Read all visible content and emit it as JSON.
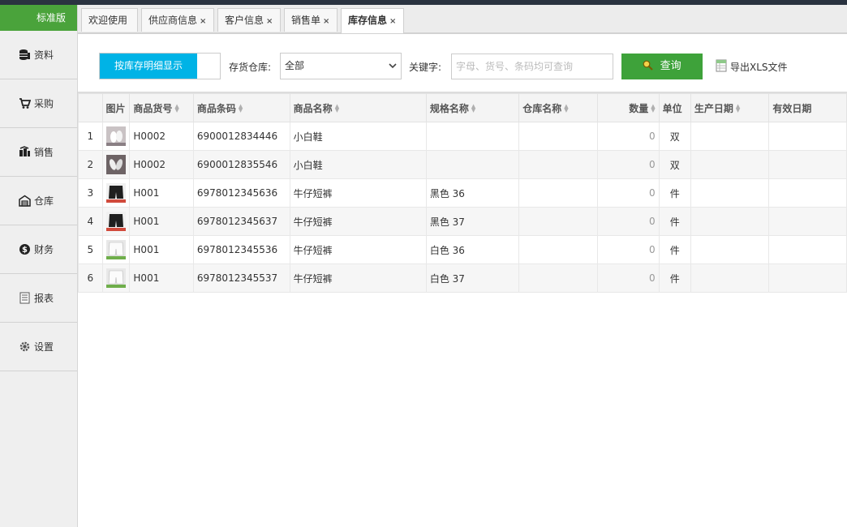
{
  "sidebar": {
    "edition": "标准版",
    "items": [
      {
        "label": "资料",
        "icon": "database-icon"
      },
      {
        "label": "采购",
        "icon": "cart-icon"
      },
      {
        "label": "销售",
        "icon": "sales-icon"
      },
      {
        "label": "仓库",
        "icon": "warehouse-icon"
      },
      {
        "label": "财务",
        "icon": "dollar-icon"
      },
      {
        "label": "报表",
        "icon": "report-icon"
      },
      {
        "label": "设置",
        "icon": "gear-icon"
      }
    ]
  },
  "tabs": [
    {
      "label": "欢迎使用"
    },
    {
      "label": "供应商信息",
      "close": "×"
    },
    {
      "label": "客户信息",
      "close": "×"
    },
    {
      "label": "销售单",
      "close": "×"
    },
    {
      "label": "库存信息",
      "close": "×",
      "active": true
    }
  ],
  "filters": {
    "detail_button": "按库存明细显示",
    "warehouse_label": "存货仓库:",
    "warehouse_value": "全部",
    "keyword_label": "关键字:",
    "keyword_placeholder": "字母、货号、条码均可查询",
    "query_button": "查询",
    "export_label": "导出XLS文件"
  },
  "table": {
    "columns": [
      "图片",
      "商品货号",
      "商品条码",
      "商品名称",
      "规格名称",
      "仓库名称",
      "数量",
      "单位",
      "生产日期",
      "有效日期"
    ],
    "rows": [
      {
        "no": "1",
        "image": "shoe-light",
        "code": "H0002",
        "barcode": "6900012834446",
        "name": "小白鞋",
        "spec": "",
        "warehouse": "",
        "qty": "0",
        "unit": "双"
      },
      {
        "no": "2",
        "image": "shoe-dark",
        "code": "H0002",
        "barcode": "6900012835546",
        "name": "小白鞋",
        "spec": "",
        "warehouse": "",
        "qty": "0",
        "unit": "双"
      },
      {
        "no": "3",
        "image": "shorts-black",
        "code": "H001",
        "barcode": "6978012345636",
        "name": "牛仔短裤",
        "spec": "黑色 36",
        "warehouse": "",
        "qty": "0",
        "unit": "件"
      },
      {
        "no": "4",
        "image": "shorts-black",
        "code": "H001",
        "barcode": "6978012345637",
        "name": "牛仔短裤",
        "spec": "黑色 37",
        "warehouse": "",
        "qty": "0",
        "unit": "件"
      },
      {
        "no": "5",
        "image": "shorts-white",
        "code": "H001",
        "barcode": "6978012345536",
        "name": "牛仔短裤",
        "spec": "白色 36",
        "warehouse": "",
        "qty": "0",
        "unit": "件"
      },
      {
        "no": "6",
        "image": "shorts-white",
        "code": "H001",
        "barcode": "6978012345537",
        "name": "牛仔短裤",
        "spec": "白色 37",
        "warehouse": "",
        "qty": "0",
        "unit": "件"
      }
    ]
  },
  "colors": {
    "brand_green": "#4aa33b",
    "query_green": "#3ea23a",
    "detail_blue": "#00b3e6"
  }
}
